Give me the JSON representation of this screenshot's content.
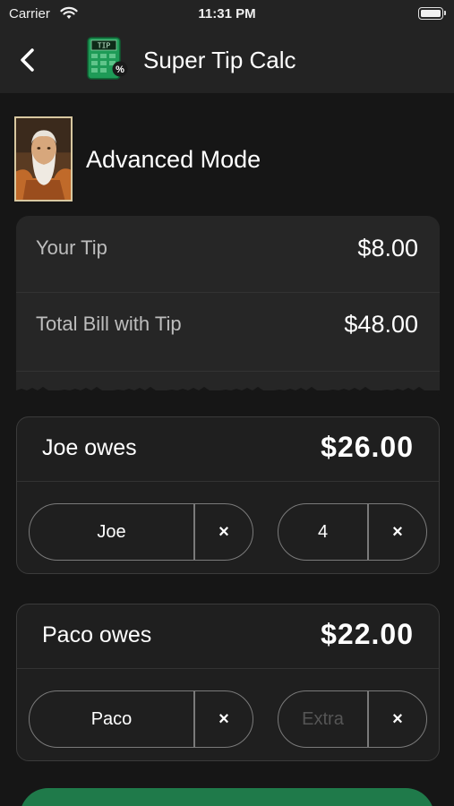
{
  "status_bar": {
    "carrier": "Carrier",
    "time": "11:31 PM"
  },
  "nav": {
    "title": "Super Tip Calc",
    "icon": "calculator-tip-icon",
    "icon_text": "TIP",
    "icon_badge": "%"
  },
  "mode": {
    "title": "Advanced Mode"
  },
  "receipt": {
    "tip_label": "Your Tip",
    "tip_value": "$8.00",
    "total_label": "Total Bill with Tip",
    "total_value": "$48.00"
  },
  "people": [
    {
      "owes_label": "Joe owes",
      "amount": "$26.00",
      "name": "Joe",
      "extra": "4",
      "extra_placeholder": "Extra"
    },
    {
      "owes_label": "Paco owes",
      "amount": "$22.00",
      "name": "Paco",
      "extra": "",
      "extra_placeholder": "Extra"
    }
  ],
  "clear_glyph": "×",
  "colors": {
    "background": "#161616",
    "bar": "#232323",
    "card": "#1f1f1f",
    "accent": "#1f7a4a"
  }
}
